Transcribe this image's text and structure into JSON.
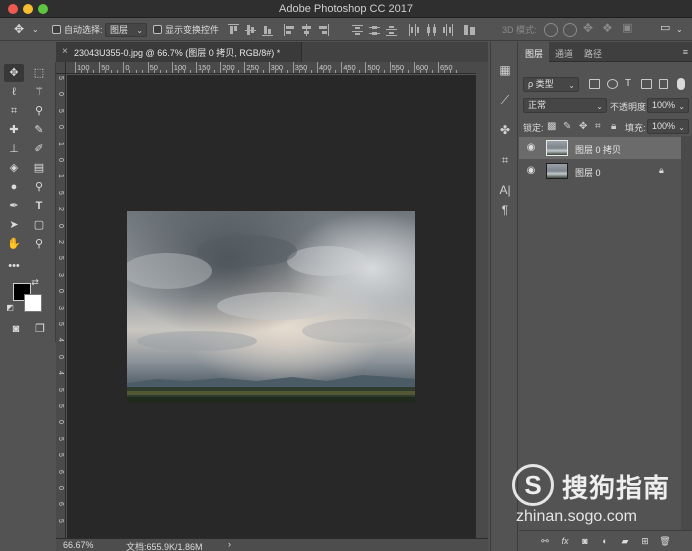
{
  "app": {
    "title": "Adobe Photoshop CC 2017"
  },
  "options_bar": {
    "auto_select_label": "自动选择:",
    "auto_select_target": "图层",
    "show_transform_label": "显示变换控件",
    "mode_3d_label": "3D 模式:"
  },
  "document": {
    "tab_title": "23043U355-0.jpg @ 66.7% (图层 0 拷贝, RGB/8#) *",
    "close_glyph": "×",
    "ruler_h_labels": [
      "100",
      "50",
      "0",
      "50",
      "100",
      "150",
      "200",
      "250",
      "300",
      "350",
      "400",
      "450",
      "500",
      "550",
      "600",
      "650"
    ],
    "ruler_v_labels": [
      "5",
      "0",
      "5",
      "0",
      "1",
      "0",
      "1",
      "5",
      "2",
      "0",
      "2",
      "5",
      "3",
      "0",
      "3",
      "5",
      "4",
      "0",
      "4",
      "5",
      "5",
      "0",
      "5",
      "5",
      "6",
      "0",
      "6",
      "5"
    ]
  },
  "status_bar": {
    "zoom": "66.67%",
    "doc_size": "文档:655.9K/1.86M",
    "arrow": "›"
  },
  "layers_panel": {
    "tabs": [
      "图层",
      "通道",
      "路径"
    ],
    "menu_glyph": "≡",
    "filter_kind": "ρ 类型",
    "blend_mode": "正常",
    "opacity_label": "不透明度:",
    "opacity_value": "100%",
    "lock_label": "锁定:",
    "fill_label": "填充:",
    "fill_value": "100%",
    "layers": [
      {
        "name": "图层 0 拷贝",
        "selected": true,
        "locked": false
      },
      {
        "name": "图层 0",
        "selected": false,
        "locked": true
      }
    ],
    "bottom_icons": [
      "link-icon",
      "fx-icon",
      "mask-icon",
      "adjustment-icon",
      "group-icon",
      "new-layer-icon",
      "trash-icon"
    ]
  },
  "watermark": {
    "logo_letter": "S",
    "brand": "搜狗指南",
    "url": "zhinan.sogo.com"
  },
  "colors": {
    "foreground": "#000000",
    "background": "#ffffff",
    "canvas_bg": "#282828",
    "panel_bg": "#535353",
    "selected_layer": "#6b6b6b"
  }
}
